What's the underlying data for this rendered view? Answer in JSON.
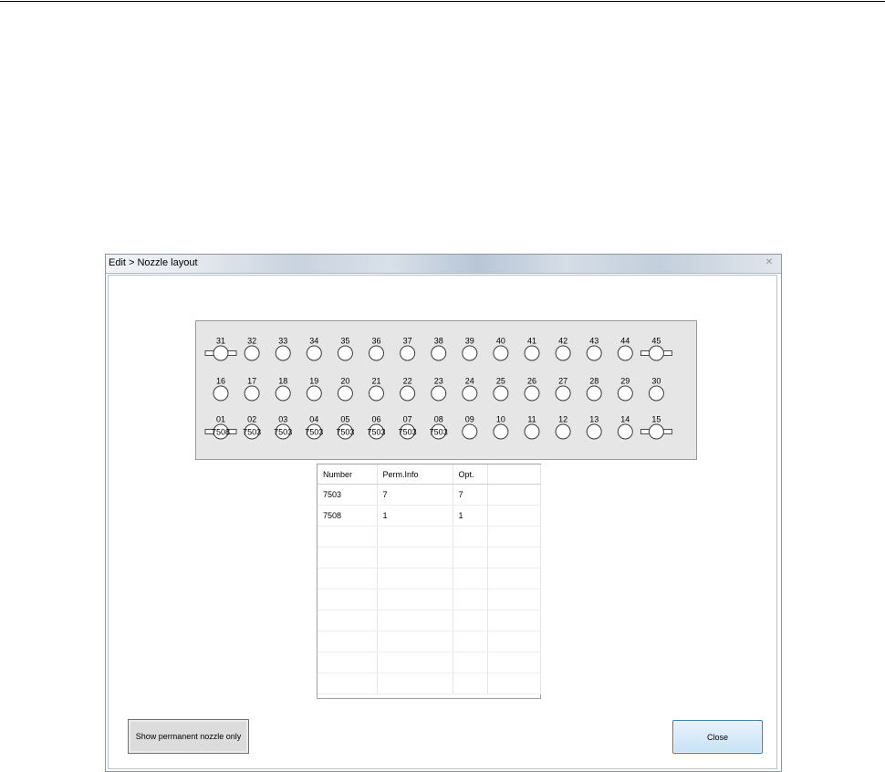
{
  "window": {
    "title": "Edit > Nozzle layout"
  },
  "nozzle_layout": {
    "rows": [
      {
        "nozzles": [
          {
            "label": "31",
            "value": "",
            "side_bar": true
          },
          {
            "label": "32",
            "value": ""
          },
          {
            "label": "33",
            "value": ""
          },
          {
            "label": "34",
            "value": ""
          },
          {
            "label": "35",
            "value": ""
          },
          {
            "label": "36",
            "value": ""
          },
          {
            "label": "37",
            "value": ""
          },
          {
            "label": "38",
            "value": ""
          },
          {
            "label": "39",
            "value": ""
          },
          {
            "label": "40",
            "value": ""
          },
          {
            "label": "41",
            "value": ""
          },
          {
            "label": "42",
            "value": ""
          },
          {
            "label": "43",
            "value": ""
          },
          {
            "label": "44",
            "value": ""
          },
          {
            "label": "45",
            "value": "",
            "side_bar": true
          }
        ]
      },
      {
        "nozzles": [
          {
            "label": "16",
            "value": ""
          },
          {
            "label": "17",
            "value": ""
          },
          {
            "label": "18",
            "value": ""
          },
          {
            "label": "19",
            "value": ""
          },
          {
            "label": "20",
            "value": ""
          },
          {
            "label": "21",
            "value": ""
          },
          {
            "label": "22",
            "value": ""
          },
          {
            "label": "23",
            "value": ""
          },
          {
            "label": "24",
            "value": ""
          },
          {
            "label": "25",
            "value": ""
          },
          {
            "label": "26",
            "value": ""
          },
          {
            "label": "27",
            "value": ""
          },
          {
            "label": "28",
            "value": ""
          },
          {
            "label": "29",
            "value": ""
          },
          {
            "label": "30",
            "value": ""
          }
        ]
      },
      {
        "nozzles": [
          {
            "label": "01",
            "value": "7508",
            "side_bar": true
          },
          {
            "label": "02",
            "value": "7503"
          },
          {
            "label": "03",
            "value": "7503"
          },
          {
            "label": "04",
            "value": "7503"
          },
          {
            "label": "05",
            "value": "7503"
          },
          {
            "label": "06",
            "value": "7503"
          },
          {
            "label": "07",
            "value": "7503"
          },
          {
            "label": "08",
            "value": "7503"
          },
          {
            "label": "09",
            "value": ""
          },
          {
            "label": "10",
            "value": ""
          },
          {
            "label": "11",
            "value": ""
          },
          {
            "label": "12",
            "value": ""
          },
          {
            "label": "13",
            "value": ""
          },
          {
            "label": "14",
            "value": ""
          },
          {
            "label": "15",
            "value": "",
            "side_bar": true
          }
        ]
      }
    ]
  },
  "table": {
    "columns": [
      "Number",
      "Perm.Info",
      "Opt.",
      ""
    ],
    "rows": [
      [
        "7503",
        "7",
        "7",
        ""
      ],
      [
        "7508",
        "1",
        "1",
        ""
      ],
      [
        "",
        "",
        "",
        ""
      ],
      [
        "",
        "",
        "",
        ""
      ],
      [
        "",
        "",
        "",
        ""
      ],
      [
        "",
        "",
        "",
        ""
      ],
      [
        "",
        "",
        "",
        ""
      ],
      [
        "",
        "",
        "",
        ""
      ],
      [
        "",
        "",
        "",
        ""
      ],
      [
        "",
        "",
        "",
        ""
      ]
    ]
  },
  "buttons": {
    "show_permanent_label": "Show permanent nozzle only",
    "close_label": "Close"
  },
  "colors": {
    "panel_background": "#e6e6e6",
    "nozzle_outline": "#3a3a3a",
    "close_button_border": "#3c7fb1"
  }
}
